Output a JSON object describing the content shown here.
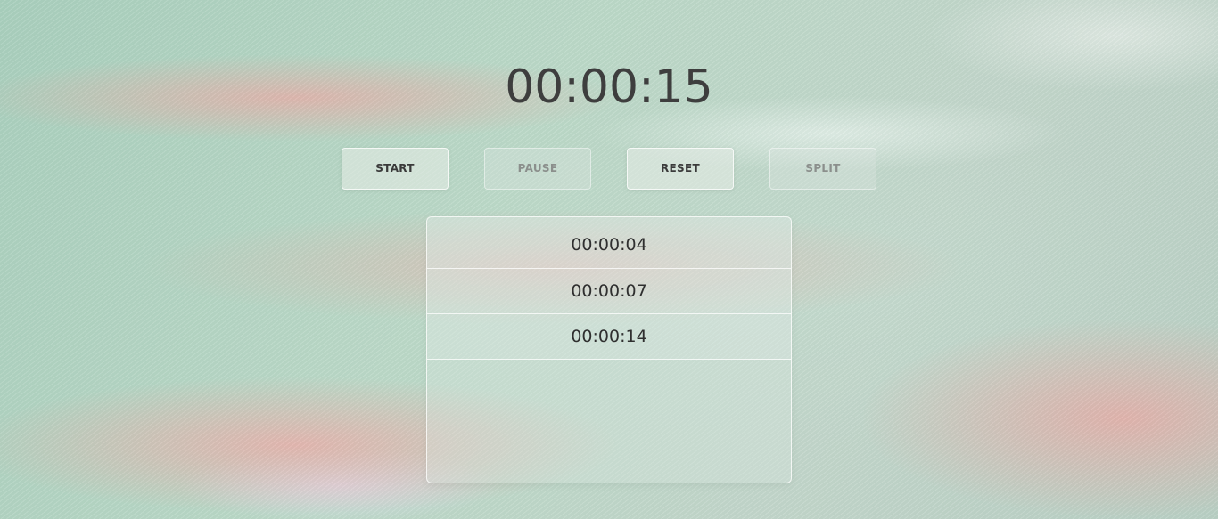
{
  "stopwatch": {
    "elapsed": "00:00:15"
  },
  "controls": {
    "start_label": "START",
    "pause_label": "PAUSE",
    "reset_label": "RESET",
    "split_label": "SPLIT",
    "pause_enabled": false,
    "split_enabled": false
  },
  "laps": [
    "00:00:04",
    "00:00:07",
    "00:00:14"
  ],
  "colors": {
    "text": "#3e3e3e",
    "disabled_text": "#8b8f8c",
    "background_green": "#b5d4c2",
    "background_pink": "#ecaaa5"
  }
}
